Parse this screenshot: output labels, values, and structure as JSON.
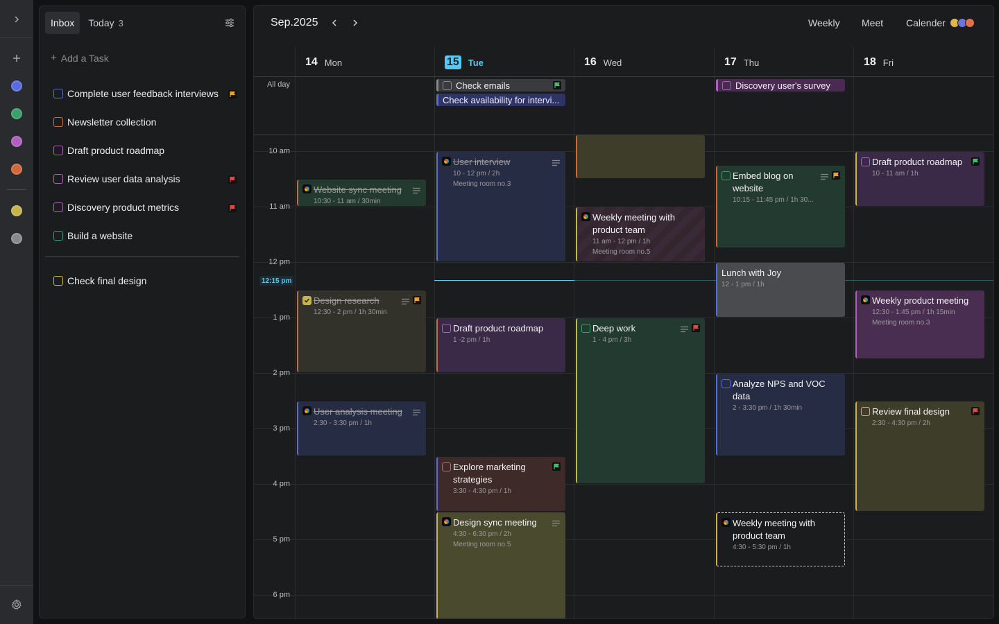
{
  "rail": {
    "icons": [
      "chevron-right-icon",
      "plus-icon",
      "settings-icon"
    ],
    "dots": [
      "#5a6be0",
      "#3aa06a",
      "#b05ec0",
      "#d0683c",
      "#c8b44a",
      "#8a8a8a"
    ]
  },
  "sidebar": {
    "tabs": [
      {
        "label": "Inbox",
        "active": true
      },
      {
        "label": "Today",
        "count": "3",
        "active": false
      }
    ],
    "add_task": "Add a Task",
    "tasks": [
      {
        "label": "Complete user feedback interviews",
        "color": "#5a6be0",
        "flag": "orange"
      },
      {
        "label": "Newsletter collection",
        "color": "#d0683c",
        "flag": ""
      },
      {
        "label": "Draft product roadmap",
        "color": "#b05ec0",
        "flag": ""
      },
      {
        "label": "Review user data analysis",
        "color": "#b05ec0",
        "flag": "red"
      },
      {
        "label": "Discovery product metrics",
        "color": "#b05ec0",
        "flag": "red"
      },
      {
        "label": "Build a website",
        "color": "#3aa06a",
        "flag": ""
      },
      {
        "label": "Check final design",
        "color": "#c8b44a",
        "flag": ""
      }
    ]
  },
  "calendar": {
    "month": "Sep.2025",
    "views": [
      "Weekly",
      "Meet",
      "Calender"
    ],
    "days": [
      {
        "num": "14",
        "name": "Mon",
        "today": false
      },
      {
        "num": "15",
        "name": "Tue",
        "today": true
      },
      {
        "num": "16",
        "name": "Wed",
        "today": false
      },
      {
        "num": "17",
        "name": "Thu",
        "today": false
      },
      {
        "num": "18",
        "name": "Fri",
        "today": false
      }
    ],
    "allday_label": "All day",
    "times": [
      "10 am",
      "11 am",
      "12 pm",
      "1 pm",
      "2 pm",
      "3 pm",
      "4 pm",
      "5 pm",
      "6 pm"
    ],
    "now_label": "12:15 pm",
    "allday_events": [
      {
        "title": "Check emails",
        "day": 1,
        "row": 0,
        "kind": "task",
        "color": "#8a8a8a",
        "bg": "#3a3b3e",
        "flag": "green"
      },
      {
        "title": "Check availability for intervi...",
        "day": 1,
        "row": 1,
        "kind": "plain",
        "color": "#5a6be0",
        "bg": "#2e3468",
        "flag": ""
      },
      {
        "title": "Discovery user's survey",
        "day": 3,
        "row": 0,
        "kind": "task",
        "color": "#b05ec0",
        "bg": "#4a2a52",
        "flag": ""
      }
    ],
    "events": [
      {
        "title": "",
        "day": 2,
        "start": 9.7,
        "end": 10.5,
        "lead": "none",
        "sub": [],
        "accent": "#d0683c",
        "bg": "#3e3d2a",
        "done": false
      },
      {
        "title": "User interview",
        "day": 1,
        "start": 10,
        "end": 12,
        "lead": "meet",
        "sub": [
          "10 - 12 pm / 2h",
          "Meeting room no.3"
        ],
        "accent": "#5a6be0",
        "bg": "#272c45",
        "done": true,
        "notes": true
      },
      {
        "title": "Embed blog on website",
        "day": 3,
        "start": 10.25,
        "end": 11.75,
        "lead": "task",
        "sub": [
          "10:15 - 11:45 pm / 1h 30..."
        ],
        "accent": "#d0683c",
        "bg": "#233a30",
        "done": false,
        "notes": true,
        "flag": "orange",
        "box": "#3aa06a"
      },
      {
        "title": "Draft product roadmap",
        "day": 4,
        "start": 10,
        "end": 11,
        "lead": "task",
        "sub": [
          "10 - 11 am / 1h"
        ],
        "accent": "#c8b44a",
        "bg": "#3a2a48",
        "done": false,
        "flag": "green",
        "box": "#b05ec0"
      },
      {
        "title": "Website sync meeting",
        "day": 0,
        "start": 10.5,
        "end": 11,
        "lead": "meet",
        "sub": [
          "10:30 - 11 am / 30min"
        ],
        "accent": "#d0683c",
        "bg": "#233a30",
        "done": true,
        "notes": true
      },
      {
        "title": "Weekly meeting with product team",
        "day": 2,
        "start": 11,
        "end": 12,
        "lead": "meet",
        "sub": [
          "11 am - 12 pm / 1h",
          "Meeting room no.5"
        ],
        "accent": "#c8b44a",
        "bg": "#3a2a38",
        "done": false,
        "striped": true
      },
      {
        "title": "Lunch with Joy",
        "day": 3,
        "start": 12,
        "end": 13,
        "lead": "none",
        "sub": [
          "12 - 1 pm / 1h"
        ],
        "accent": "#5a6be0",
        "bg": "#4a4b4e",
        "done": false
      },
      {
        "title": "Design research",
        "day": 0,
        "start": 12.5,
        "end": 14,
        "lead": "checked",
        "sub": [
          "12:30 - 2 pm / 1h 30min"
        ],
        "accent": "#d0683c",
        "bg": "#33322a",
        "done": true,
        "notes2": true,
        "flag": "orange",
        "box": "#c8b44a"
      },
      {
        "title": "Weekly product meeting",
        "day": 4,
        "start": 12.5,
        "end": 13.75,
        "lead": "meet",
        "sub": [
          "12:30 - 1:45 pm / 1h 15min",
          "Meeting room no.3"
        ],
        "accent": "#b05ec0",
        "bg": "#4a2e52",
        "done": false
      },
      {
        "title": "Draft product roadmap",
        "day": 1,
        "start": 13,
        "end": 14,
        "lead": "task",
        "sub": [
          "1 -2 pm / 1h"
        ],
        "accent": "#d0683c",
        "bg": "#3a2a48",
        "done": false,
        "box": "#b05ec0"
      },
      {
        "title": "Deep work",
        "day": 2,
        "start": 13,
        "end": 16,
        "lead": "task",
        "sub": [
          "1 - 4 pm / 3h"
        ],
        "accent": "#c8b44a",
        "bg": "#233a30",
        "done": false,
        "notes2": true,
        "flag": "red",
        "box": "#3aa06a"
      },
      {
        "title": "Analyze NPS and VOC data",
        "day": 3,
        "start": 14,
        "end": 15.5,
        "lead": "task",
        "sub": [
          "2 - 3:30 pm / 1h 30min"
        ],
        "accent": "#5a6be0",
        "bg": "#272c45",
        "done": false,
        "box": "#5a6be0"
      },
      {
        "title": "User analysis meeting",
        "day": 0,
        "start": 14.5,
        "end": 15.5,
        "lead": "meet",
        "sub": [
          "2:30 - 3:30 pm / 1h"
        ],
        "accent": "#5a6be0",
        "bg": "#272c45",
        "done": true,
        "notes": true
      },
      {
        "title": "Review final design",
        "day": 4,
        "start": 14.5,
        "end": 16.5,
        "lead": "task",
        "sub": [
          "2:30 - 4:30 pm / 2h"
        ],
        "accent": "#c8b44a",
        "bg": "#3e3d2a",
        "done": false,
        "flag": "red",
        "box": "#c8b44a"
      },
      {
        "title": "Explore marketing strategies",
        "day": 1,
        "start": 15.5,
        "end": 16.5,
        "lead": "task",
        "sub": [
          "3:30 - 4:30 pm / 1h"
        ],
        "accent": "#5a6be0",
        "bg": "#3e2a28",
        "done": false,
        "flag": "green",
        "box": "#d0683c"
      },
      {
        "title": "Design sync meeting",
        "day": 1,
        "start": 16.5,
        "end": 18.5,
        "lead": "meet",
        "sub": [
          "4:30 - 6:30 pm / 2h",
          "Meeting room no.5"
        ],
        "accent": "#c8b44a",
        "bg": "#4a4a2e",
        "done": false,
        "notes": true
      },
      {
        "title": "Weekly meeting with product team",
        "day": 3,
        "start": 16.5,
        "end": 17.5,
        "lead": "meet",
        "sub": [
          "4:30 - 5:30 pm / 1h"
        ],
        "accent": "#c8b44a",
        "bg": "#1b1c1e",
        "done": false,
        "dashed": true
      }
    ]
  }
}
